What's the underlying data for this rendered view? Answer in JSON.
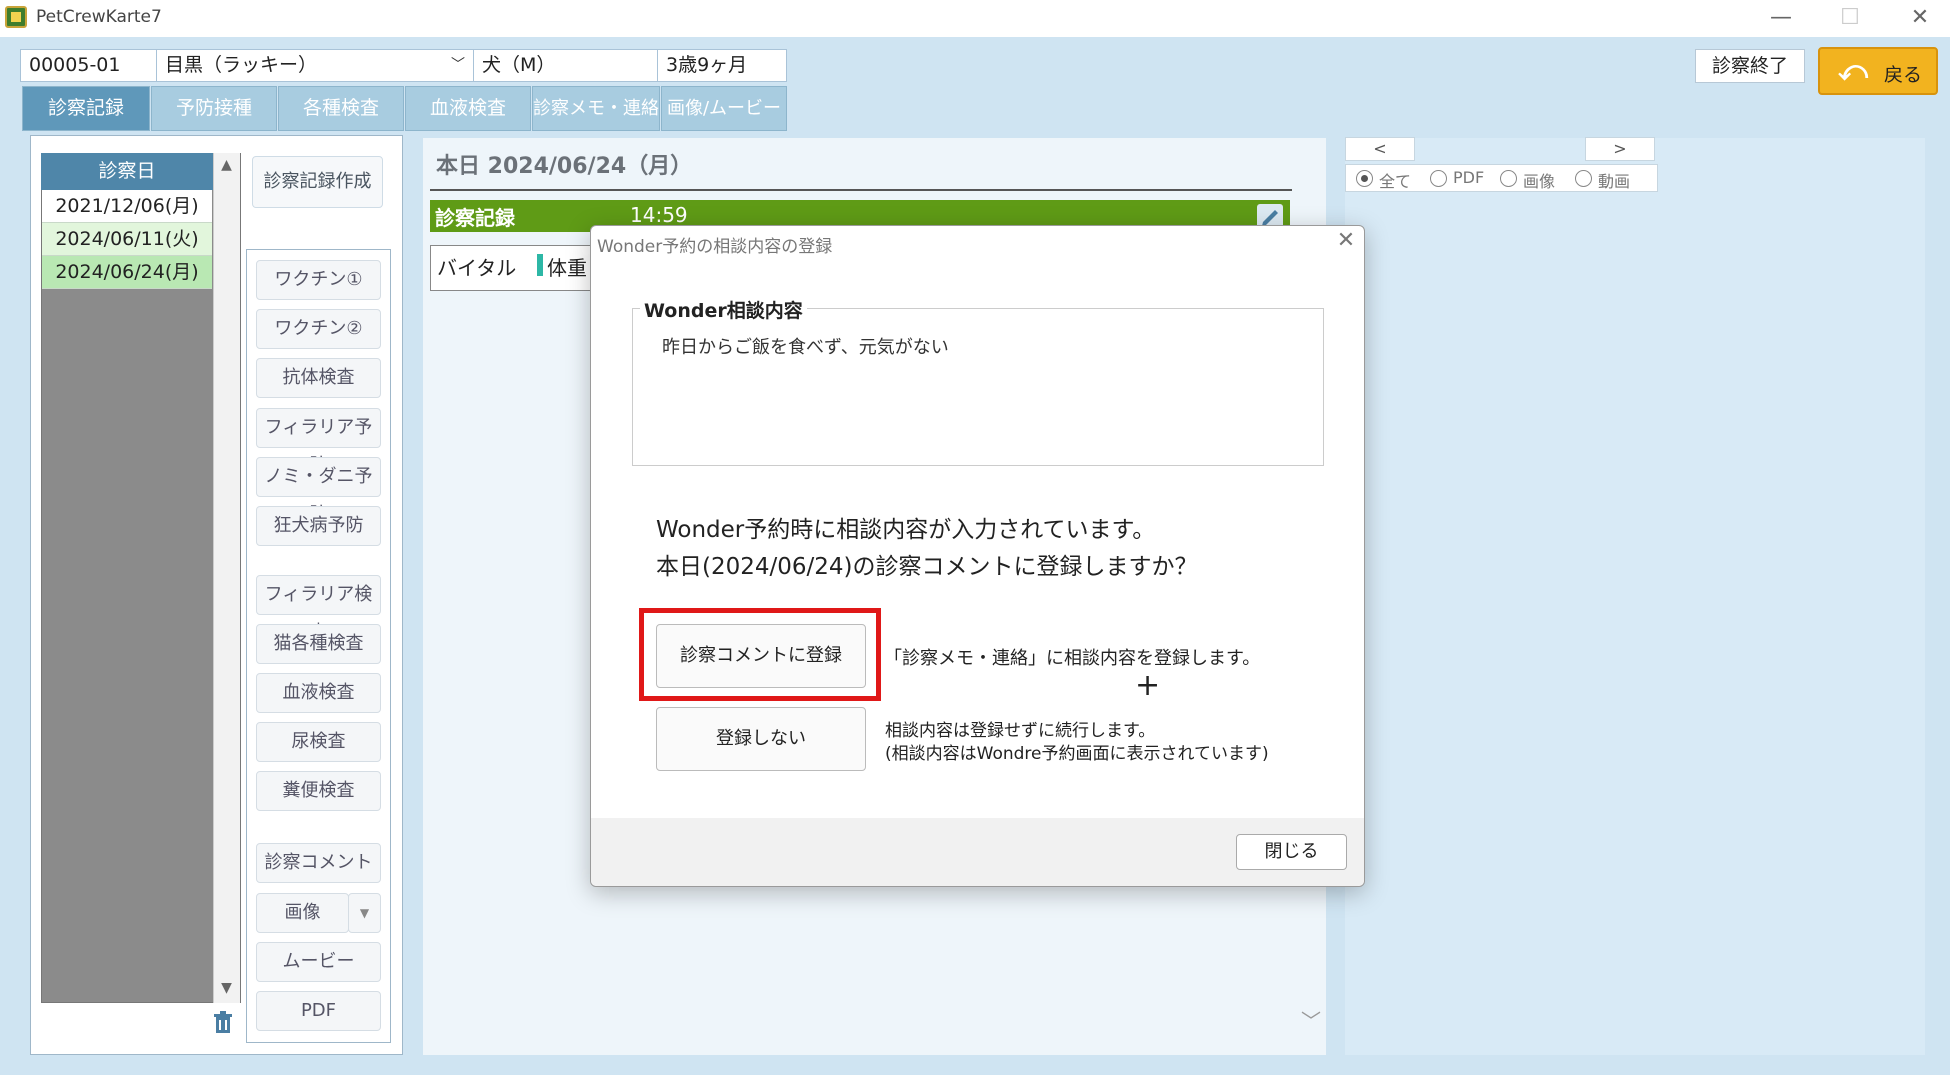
{
  "window": {
    "title": "PetCrewKarte7",
    "minimize_glyph": "—",
    "maximize_glyph": "☐",
    "close_glyph": "✕"
  },
  "patient": {
    "id": "00005-01",
    "name": "目黒（ラッキー）",
    "species": "犬（M）",
    "age": "3歳9ヶ月"
  },
  "header": {
    "end_consult_label": "診察終了",
    "back_label": "戻る",
    "back_icon": "undo-arrow-icon"
  },
  "tabs": [
    {
      "label": "診察記録",
      "active": true
    },
    {
      "label": "予防接種",
      "active": false
    },
    {
      "label": "各種検査",
      "active": false
    },
    {
      "label": "血液検査",
      "active": false
    },
    {
      "label": "診察メモ・連絡",
      "active": false
    },
    {
      "label": "画像/ムービー",
      "active": false
    }
  ],
  "date_list": {
    "header": "診察日",
    "dates": [
      "2021/12/06(月)",
      "2024/06/11(火)",
      "2024/06/24(月)"
    ],
    "selected_index": 2
  },
  "side": {
    "create_record_label": "診察記録作成",
    "buttons": [
      "ワクチン①",
      "ワクチン②",
      "抗体検査",
      "フィラリア予防",
      "ノミ・ダニ予防",
      "狂犬病予防",
      "フィラリア検査",
      "猫各種検査",
      "血液検査",
      "尿検査",
      "糞便検査",
      "診察コメント",
      "画像",
      "ムービー",
      "PDF"
    ]
  },
  "center": {
    "today_label": "本日 2024/06/24（月）",
    "record_title": "診察記録",
    "record_time": "14:59",
    "vital_label": "バイタル",
    "weight_label": "体重"
  },
  "right": {
    "prev_label": "<",
    "next_label": ">",
    "filters": [
      {
        "label": "全て",
        "checked": true
      },
      {
        "label": "PDF",
        "checked": false
      },
      {
        "label": "画像",
        "checked": false
      },
      {
        "label": "動画",
        "checked": false
      }
    ]
  },
  "dialog": {
    "title": "Wonder予約の相談内容の登録",
    "consult_legend": "Wonder相談内容",
    "consult_text": "昨日からご飯を食べず、元気がない",
    "message_line1": "Wonder予約時に相談内容が入力されています。",
    "message_line2": "本日(2024/06/24)の診察コメントに登録しますか？",
    "register_button": "診察コメントに登録",
    "register_desc": "「診察メモ・連絡」に相談内容を登録します。",
    "plus": "+",
    "no_register_button": "登録しない",
    "no_register_desc1": "相談内容は登録せずに続行します。",
    "no_register_desc2": "(相談内容はWondre予約画面に表示されています)",
    "close_button": "閉じる",
    "highlight_color": "#e01818"
  }
}
